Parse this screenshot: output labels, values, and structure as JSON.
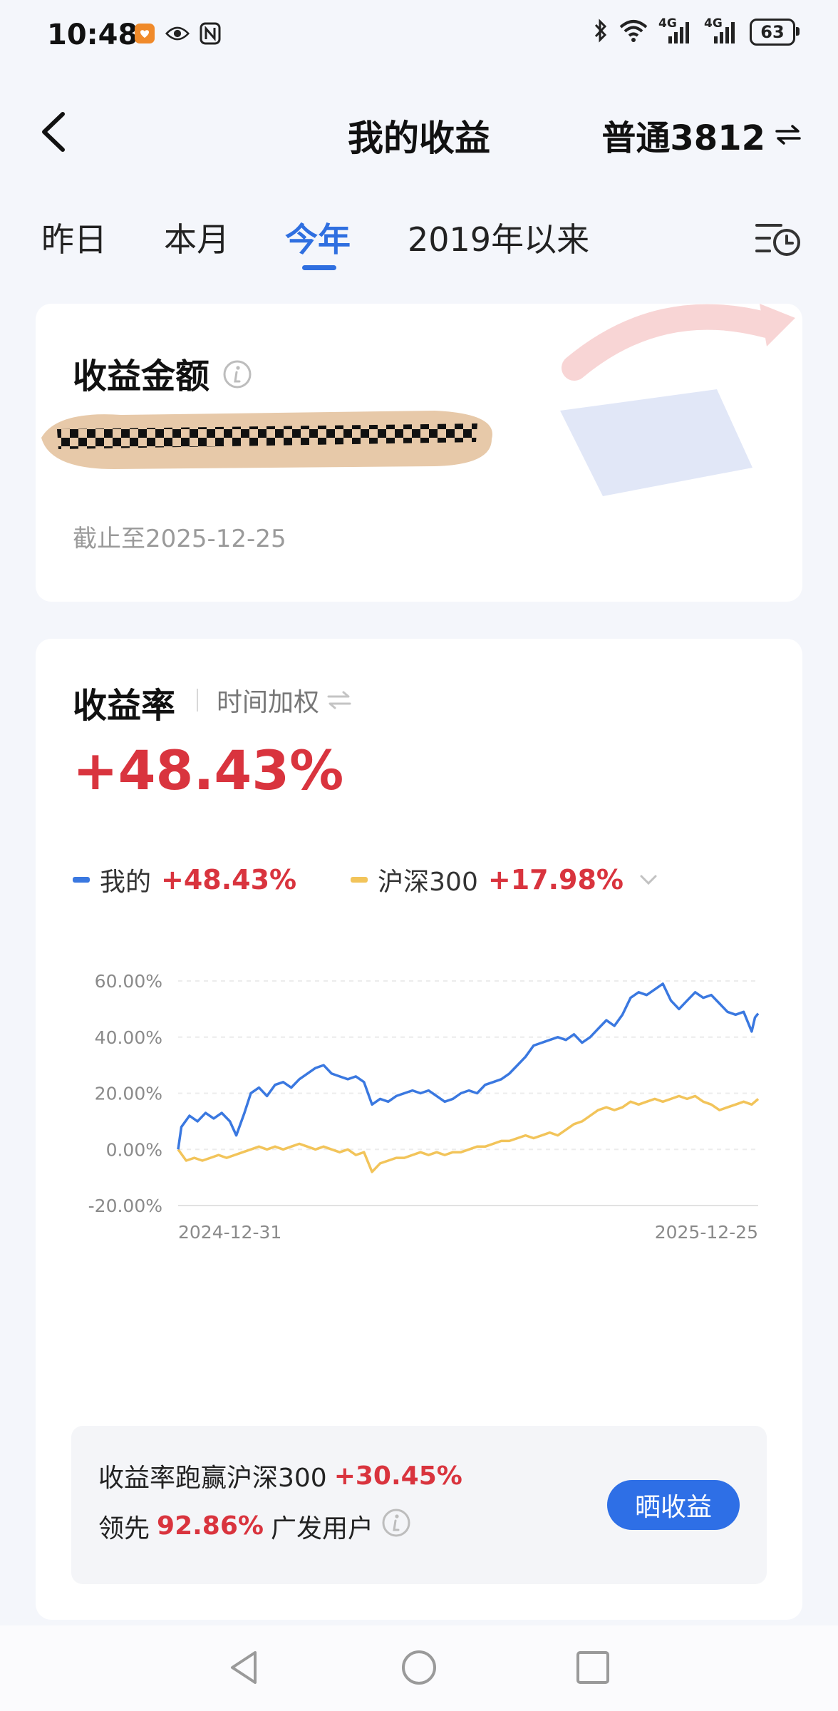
{
  "status_bar": {
    "time": "10:48",
    "net1": "4G",
    "net2": "4G",
    "battery": "63"
  },
  "header": {
    "title": "我的收益",
    "account": "普通3812"
  },
  "tabs": [
    {
      "label": "昨日",
      "active": false
    },
    {
      "label": "本月",
      "active": false
    },
    {
      "label": "今年",
      "active": true
    },
    {
      "label": "2019年以来",
      "active": false
    }
  ],
  "amount_card": {
    "title": "收益金额",
    "date": "截止至2025-12-25"
  },
  "return_card": {
    "title": "收益率",
    "method": "时间加权",
    "value": "+48.43%",
    "legend": [
      {
        "name": "我的",
        "value": "+48.43%",
        "color": "#3a78e0"
      },
      {
        "name": "沪深300",
        "value": "+17.98%",
        "color": "#f2c45a"
      }
    ]
  },
  "chart_data": {
    "type": "line",
    "x_start_label": "2024-12-31",
    "x_end_label": "2025-12-25",
    "y_tick_labels": [
      "60.00%",
      "40.00%",
      "20.00%",
      "0.00%",
      "-20.00%"
    ],
    "ylim": [
      -20,
      60
    ],
    "xlim": [
      "2024-12-31",
      "2025-12-25"
    ],
    "series": [
      {
        "name": "我的",
        "color": "#3a78e0",
        "points": [
          [
            "2024-12-31",
            0
          ],
          [
            "2025-01-02",
            8
          ],
          [
            "2025-01-07",
            12
          ],
          [
            "2025-01-12",
            10
          ],
          [
            "2025-01-17",
            13
          ],
          [
            "2025-01-22",
            11
          ],
          [
            "2025-01-27",
            13
          ],
          [
            "2025-02-01",
            10
          ],
          [
            "2025-02-05",
            5
          ],
          [
            "2025-02-10",
            13
          ],
          [
            "2025-02-14",
            20
          ],
          [
            "2025-02-19",
            22
          ],
          [
            "2025-02-24",
            19
          ],
          [
            "2025-03-01",
            23
          ],
          [
            "2025-03-06",
            24
          ],
          [
            "2025-03-11",
            22
          ],
          [
            "2025-03-16",
            25
          ],
          [
            "2025-03-21",
            27
          ],
          [
            "2025-03-26",
            29
          ],
          [
            "2025-03-31",
            30
          ],
          [
            "2025-04-05",
            27
          ],
          [
            "2025-04-10",
            26
          ],
          [
            "2025-04-15",
            25
          ],
          [
            "2025-04-20",
            26
          ],
          [
            "2025-04-25",
            24
          ],
          [
            "2025-04-30",
            16
          ],
          [
            "2025-05-05",
            18
          ],
          [
            "2025-05-10",
            17
          ],
          [
            "2025-05-15",
            19
          ],
          [
            "2025-05-20",
            20
          ],
          [
            "2025-05-25",
            21
          ],
          [
            "2025-05-30",
            20
          ],
          [
            "2025-06-04",
            21
          ],
          [
            "2025-06-09",
            19
          ],
          [
            "2025-06-14",
            17
          ],
          [
            "2025-06-19",
            18
          ],
          [
            "2025-06-24",
            20
          ],
          [
            "2025-06-29",
            21
          ],
          [
            "2025-07-04",
            20
          ],
          [
            "2025-07-09",
            23
          ],
          [
            "2025-07-14",
            24
          ],
          [
            "2025-07-19",
            25
          ],
          [
            "2025-07-24",
            27
          ],
          [
            "2025-07-29",
            30
          ],
          [
            "2025-08-03",
            33
          ],
          [
            "2025-08-08",
            37
          ],
          [
            "2025-08-13",
            38
          ],
          [
            "2025-08-18",
            39
          ],
          [
            "2025-08-23",
            40
          ],
          [
            "2025-08-28",
            39
          ],
          [
            "2025-09-02",
            41
          ],
          [
            "2025-09-07",
            38
          ],
          [
            "2025-09-12",
            40
          ],
          [
            "2025-09-17",
            43
          ],
          [
            "2025-09-22",
            46
          ],
          [
            "2025-09-27",
            44
          ],
          [
            "2025-10-02",
            48
          ],
          [
            "2025-10-07",
            54
          ],
          [
            "2025-10-12",
            56
          ],
          [
            "2025-10-17",
            55
          ],
          [
            "2025-10-22",
            57
          ],
          [
            "2025-10-27",
            59
          ],
          [
            "2025-11-01",
            53
          ],
          [
            "2025-11-06",
            50
          ],
          [
            "2025-11-11",
            53
          ],
          [
            "2025-11-16",
            56
          ],
          [
            "2025-11-21",
            54
          ],
          [
            "2025-11-26",
            55
          ],
          [
            "2025-12-01",
            52
          ],
          [
            "2025-12-06",
            49
          ],
          [
            "2025-12-11",
            48
          ],
          [
            "2025-12-16",
            49
          ],
          [
            "2025-12-21",
            42
          ],
          [
            "2025-12-23",
            47
          ],
          [
            "2025-12-25",
            48.43
          ]
        ]
      },
      {
        "name": "沪深300",
        "color": "#f2c45a",
        "points": [
          [
            "2024-12-31",
            0
          ],
          [
            "2025-01-05",
            -4
          ],
          [
            "2025-01-10",
            -3
          ],
          [
            "2025-01-15",
            -4
          ],
          [
            "2025-01-20",
            -3
          ],
          [
            "2025-01-25",
            -2
          ],
          [
            "2025-01-30",
            -3
          ],
          [
            "2025-02-04",
            -2
          ],
          [
            "2025-02-09",
            -1
          ],
          [
            "2025-02-14",
            0
          ],
          [
            "2025-02-19",
            1
          ],
          [
            "2025-02-24",
            0
          ],
          [
            "2025-03-01",
            1
          ],
          [
            "2025-03-06",
            0
          ],
          [
            "2025-03-11",
            1
          ],
          [
            "2025-03-16",
            2
          ],
          [
            "2025-03-21",
            1
          ],
          [
            "2025-03-26",
            0
          ],
          [
            "2025-03-31",
            1
          ],
          [
            "2025-04-05",
            0
          ],
          [
            "2025-04-10",
            -1
          ],
          [
            "2025-04-15",
            0
          ],
          [
            "2025-04-20",
            -2
          ],
          [
            "2025-04-25",
            -1
          ],
          [
            "2025-04-30",
            -8
          ],
          [
            "2025-05-05",
            -5
          ],
          [
            "2025-05-10",
            -4
          ],
          [
            "2025-05-15",
            -3
          ],
          [
            "2025-05-20",
            -3
          ],
          [
            "2025-05-25",
            -2
          ],
          [
            "2025-05-30",
            -1
          ],
          [
            "2025-06-04",
            -2
          ],
          [
            "2025-06-09",
            -1
          ],
          [
            "2025-06-14",
            -2
          ],
          [
            "2025-06-19",
            -1
          ],
          [
            "2025-06-24",
            -1
          ],
          [
            "2025-06-29",
            0
          ],
          [
            "2025-07-04",
            1
          ],
          [
            "2025-07-09",
            1
          ],
          [
            "2025-07-14",
            2
          ],
          [
            "2025-07-19",
            3
          ],
          [
            "2025-07-24",
            3
          ],
          [
            "2025-07-29",
            4
          ],
          [
            "2025-08-03",
            5
          ],
          [
            "2025-08-08",
            4
          ],
          [
            "2025-08-13",
            5
          ],
          [
            "2025-08-18",
            6
          ],
          [
            "2025-08-23",
            5
          ],
          [
            "2025-08-28",
            7
          ],
          [
            "2025-09-02",
            9
          ],
          [
            "2025-09-07",
            10
          ],
          [
            "2025-09-12",
            12
          ],
          [
            "2025-09-17",
            14
          ],
          [
            "2025-09-22",
            15
          ],
          [
            "2025-09-27",
            14
          ],
          [
            "2025-10-02",
            15
          ],
          [
            "2025-10-07",
            17
          ],
          [
            "2025-10-12",
            16
          ],
          [
            "2025-10-17",
            17
          ],
          [
            "2025-10-22",
            18
          ],
          [
            "2025-10-27",
            17
          ],
          [
            "2025-11-01",
            18
          ],
          [
            "2025-11-06",
            19
          ],
          [
            "2025-11-11",
            18
          ],
          [
            "2025-11-16",
            19
          ],
          [
            "2025-11-21",
            17
          ],
          [
            "2025-11-26",
            16
          ],
          [
            "2025-12-01",
            14
          ],
          [
            "2025-12-06",
            15
          ],
          [
            "2025-12-11",
            16
          ],
          [
            "2025-12-16",
            17
          ],
          [
            "2025-12-21",
            16
          ],
          [
            "2025-12-25",
            17.98
          ]
        ]
      }
    ]
  },
  "summary": {
    "line1_label": "收益率跑赢沪深300",
    "line1_value": "+30.45%",
    "line2_prefix": "领先",
    "line2_value": "92.86%",
    "line2_suffix": "广发用户",
    "share_button": "晒收益"
  },
  "colors": {
    "accent": "#2f6fe0",
    "positive": "#d9343e",
    "series_mine": "#3a78e0",
    "series_index": "#f2c45a"
  },
  "icons": {
    "back": "back-arrow-icon",
    "switch": "swap-arrows-icon",
    "history": "list-clock-icon",
    "info": "info-icon",
    "dropdown": "chevron-down-icon"
  }
}
